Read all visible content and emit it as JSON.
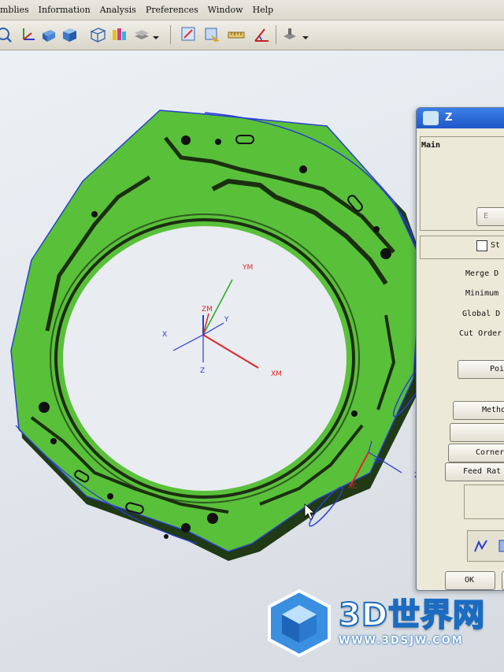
{
  "menu": {
    "items": [
      "mblies",
      "Information",
      "Analysis",
      "Preferences",
      "Window",
      "Help"
    ]
  },
  "toolbar": {
    "icons": [
      "fit-view-icon",
      "wcs-icon",
      "shaded-icon",
      "view-cube-icon",
      "wireframe-icon",
      "color-icon",
      "layer-icon",
      "dropdown-icon",
      "measure-icon",
      "section-icon",
      "ruler-icon",
      "angle-icon",
      "stamp-icon",
      "dropdown-icon"
    ]
  },
  "viewport": {
    "axis_labels": {
      "ym": "YM",
      "zm": "ZM",
      "y": "Y",
      "x": "X",
      "z": "Z",
      "xm": "XM",
      "xc": "XC",
      "zc": "ZC",
      "xc2": "XC"
    },
    "colors": {
      "part_green": "#59c03a",
      "part_shadow": "#1f3a14",
      "edge_blue": "#2c3fd0",
      "axis_red": "#e0262a",
      "axis_green": "#2aa52a",
      "axis_blue": "#2a3bd0"
    }
  },
  "dialog": {
    "title": "Z",
    "group_label": "Main",
    "btn_top": "E",
    "checkbox_label": "St",
    "labels": [
      "Merge D",
      "Minimum",
      "Global D",
      "Cut Order"
    ],
    "buttons": [
      "Poin",
      "Metho",
      "",
      "Corner",
      "Feed Rat"
    ],
    "ok": "OK"
  },
  "watermark": {
    "text": "3D世界网",
    "url": "WWW.3DSJW.COM"
  }
}
